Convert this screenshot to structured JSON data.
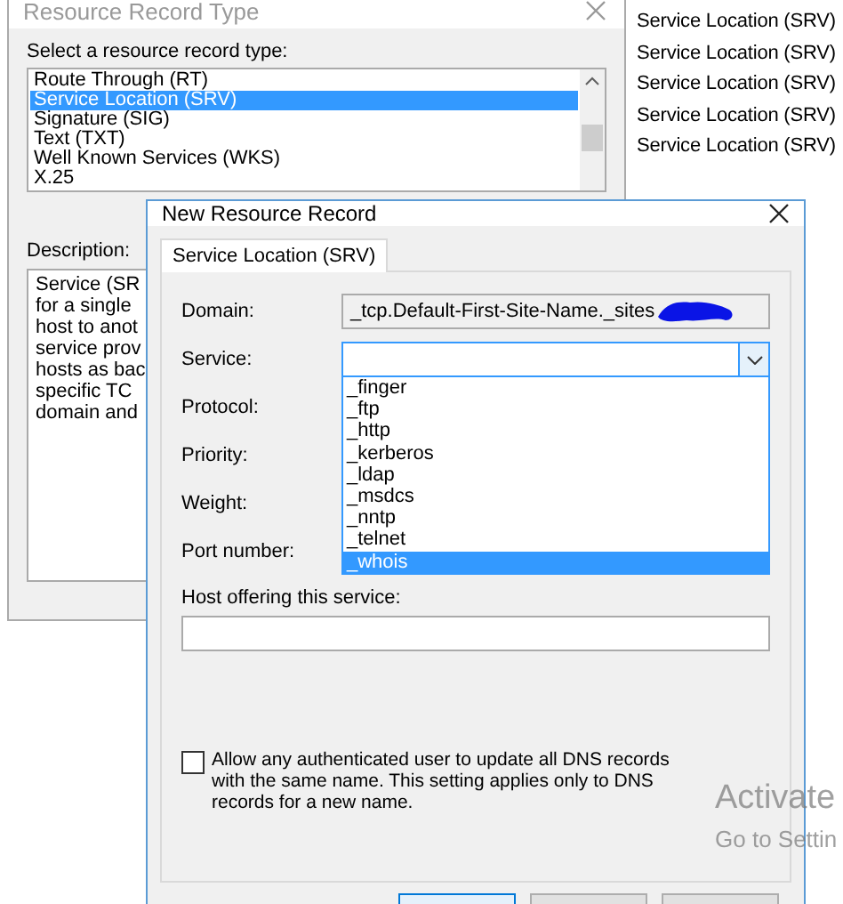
{
  "background_window": {
    "title": "Resource Record Type",
    "list_label": "Select a resource record type:",
    "record_types": [
      {
        "label": "Route Through (RT)",
        "selected": false
      },
      {
        "label": "Service Location (SRV)",
        "selected": true
      },
      {
        "label": "Signature (SIG)",
        "selected": false
      },
      {
        "label": "Text (TXT)",
        "selected": false
      },
      {
        "label": "Well Known Services (WKS)",
        "selected": false
      },
      {
        "label": "X.25",
        "selected": false
      }
    ],
    "description_label": "Description:",
    "description_lines": [
      "Service (SR",
      "for a single",
      "host to anot",
      "service prov",
      "hosts as bac",
      "specific TC",
      "domain and"
    ]
  },
  "side_list": [
    "Service Location (SRV)",
    "Service Location (SRV)",
    "Service Location (SRV)",
    "Service Location (SRV)",
    "Service Location (SRV)"
  ],
  "dialog": {
    "title": "New Resource Record",
    "tab": {
      "label": "Service Location (SRV)",
      "selected": true
    },
    "domain": {
      "label": "Domain:",
      "value": "_tcp.Default-First-Site-Name._sites"
    },
    "service": {
      "label": "Service:",
      "expanded": true,
      "options": [
        {
          "label": "_finger",
          "selected": false
        },
        {
          "label": "_ftp",
          "selected": false
        },
        {
          "label": "_http",
          "selected": false
        },
        {
          "label": "_kerberos",
          "selected": false
        },
        {
          "label": "_ldap",
          "selected": false
        },
        {
          "label": "_msdcs",
          "selected": false
        },
        {
          "label": "_nntp",
          "selected": false
        },
        {
          "label": "_telnet",
          "selected": false
        },
        {
          "label": "_whois",
          "selected": true
        }
      ]
    },
    "field_labels": [
      "Protocol:",
      "Priority:",
      "Weight:",
      "Port number:"
    ],
    "host_label": "Host offering this service:",
    "checkbox": {
      "label": "Allow any authenticated user to update all DNS records with the same name. This setting applies only to DNS records for a new name.",
      "checked": false
    },
    "buttons": [
      {
        "primary": true
      },
      {
        "primary": false
      },
      {
        "primary": false
      }
    ]
  },
  "overlay": [
    "Activate",
    "Go to Settin"
  ]
}
